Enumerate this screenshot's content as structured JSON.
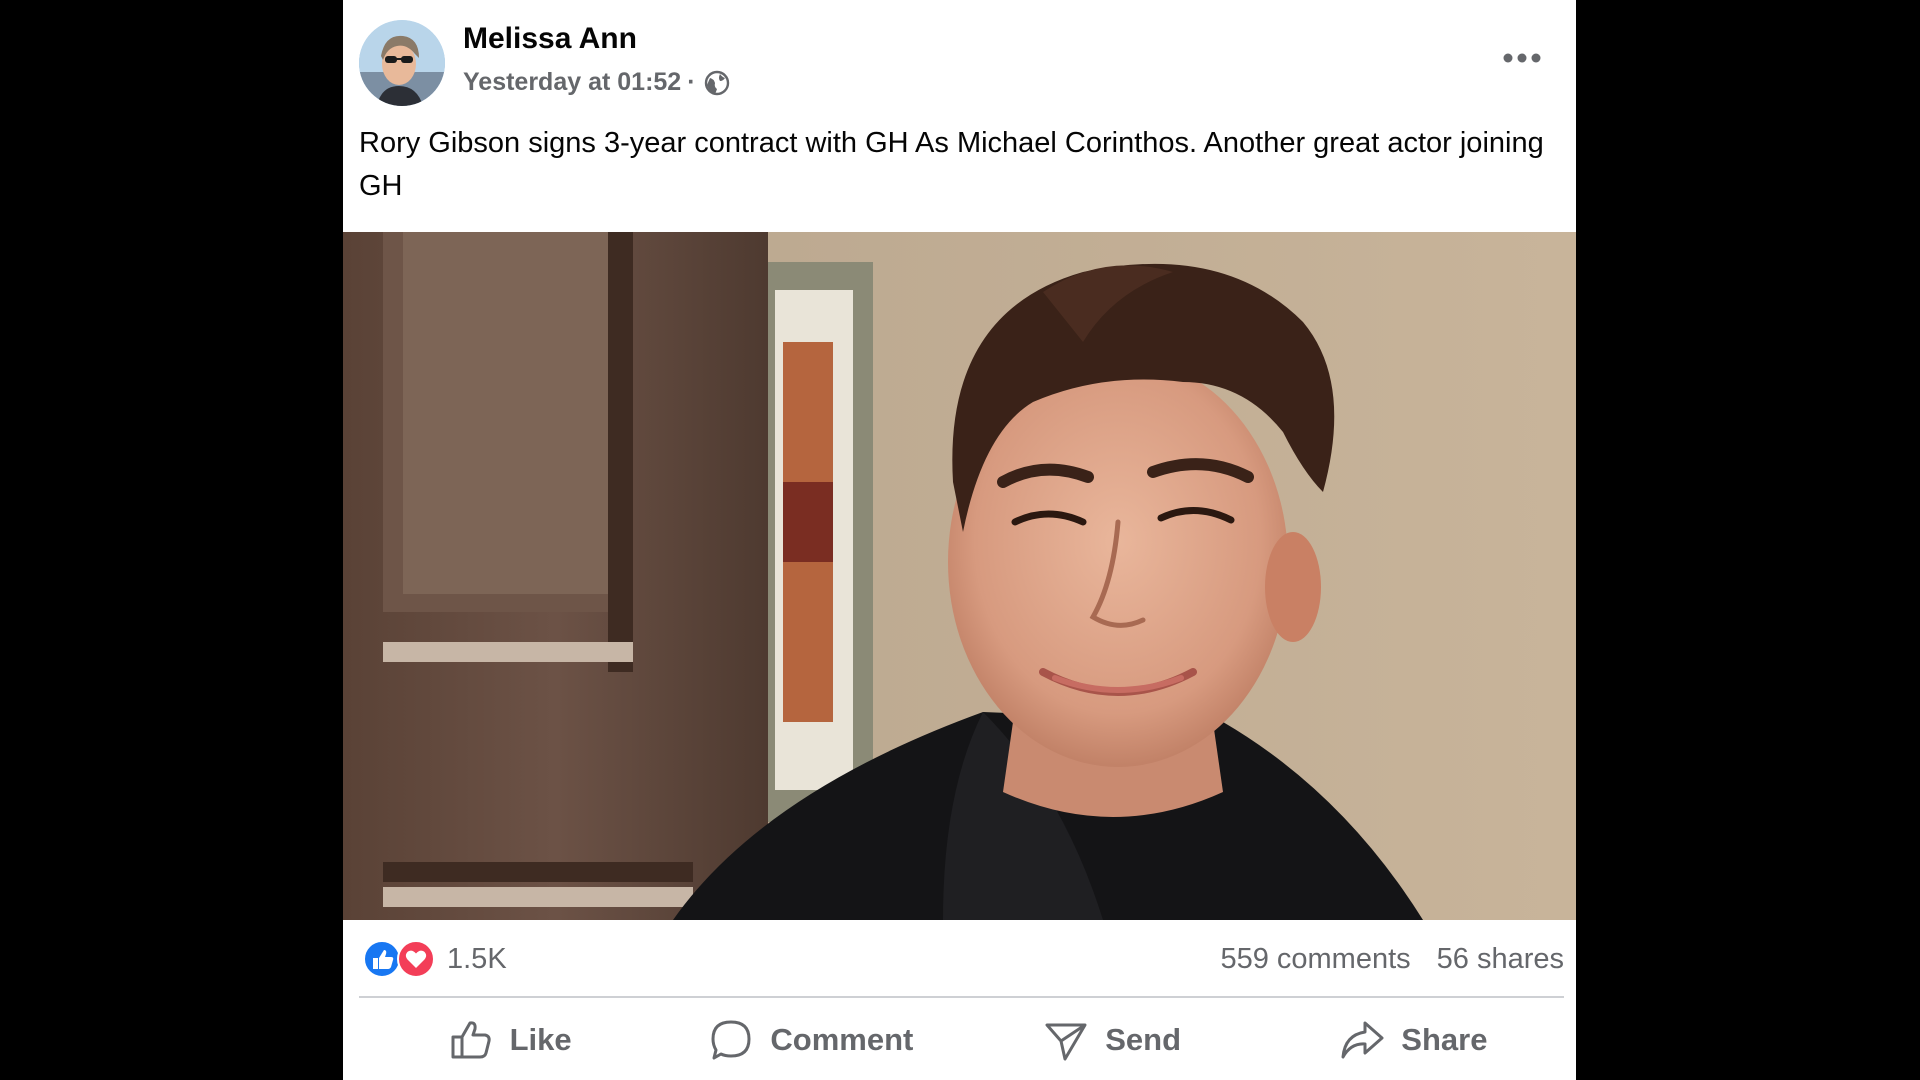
{
  "post": {
    "author": "Melissa Ann",
    "timestamp": "Yesterday at 01:52",
    "separator": "·",
    "privacy_icon": "globe-icon",
    "more_icon": "more-options-icon",
    "text": "Rory Gibson signs 3-year contract with GH As Michael Corinthos. Another great actor joining GH"
  },
  "stats": {
    "reaction_icons": [
      "like-reaction-icon",
      "love-reaction-icon"
    ],
    "reaction_count": "1.5K",
    "comments": "559 comments",
    "shares": "56 shares"
  },
  "actions": {
    "like_label": "Like",
    "comment_label": "Comment",
    "send_label": "Send",
    "share_label": "Share"
  },
  "colors": {
    "background": "#000000",
    "card": "#ffffff",
    "text_primary": "#050505",
    "text_secondary": "#65676b",
    "like_blue": "#1877f2",
    "love_red": "#f33e58",
    "divider": "#ced0d4"
  }
}
